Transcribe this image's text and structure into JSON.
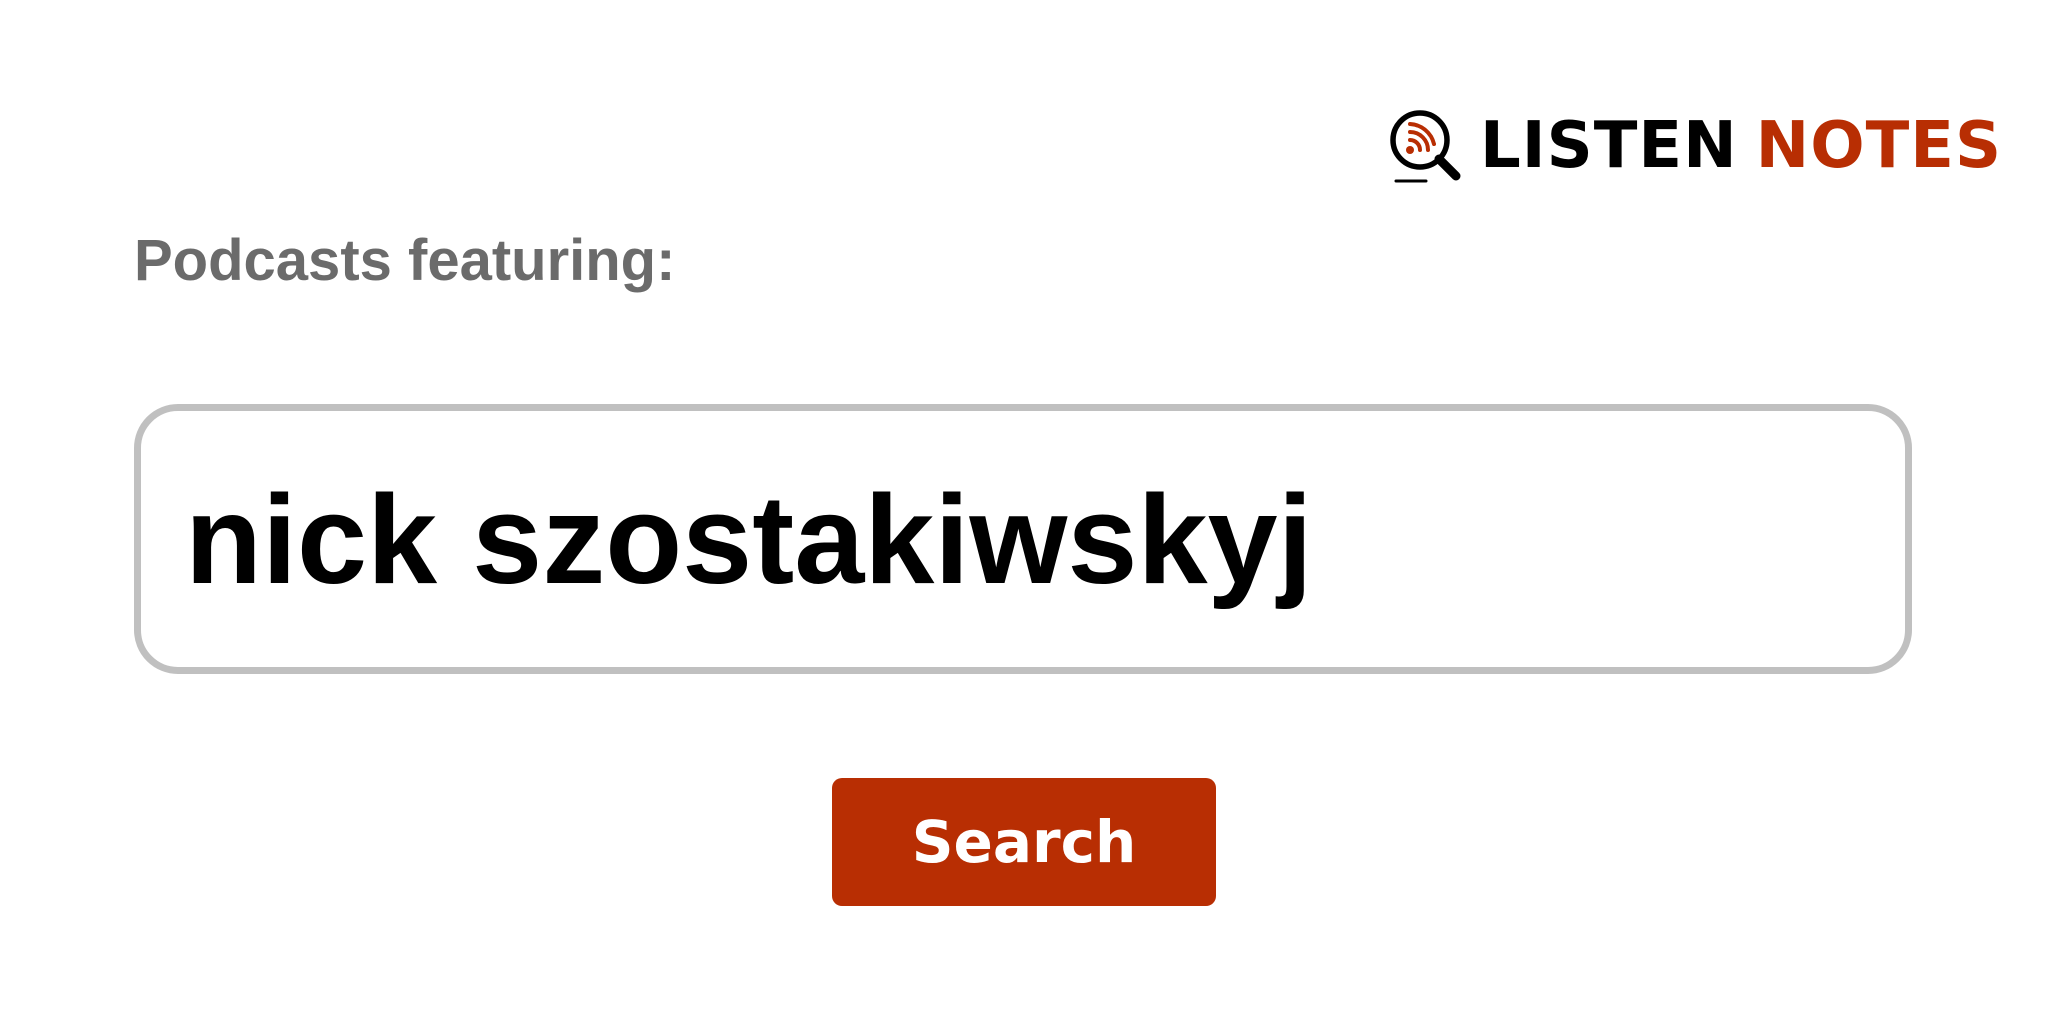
{
  "brand": {
    "name_part1": "LISTEN",
    "name_part2": "NOTES",
    "color_dark": "#000000",
    "color_accent": "#b82e03",
    "icon": "magnifier-podcast-icon"
  },
  "heading": "Podcasts featuring:",
  "search": {
    "value": "nick szostakiwskyj",
    "button_label": "Search"
  },
  "colors": {
    "heading": "#6b6b6b",
    "input_border": "#c0c0c0",
    "button_bg": "#b82e03",
    "button_text": "#ffffff"
  }
}
